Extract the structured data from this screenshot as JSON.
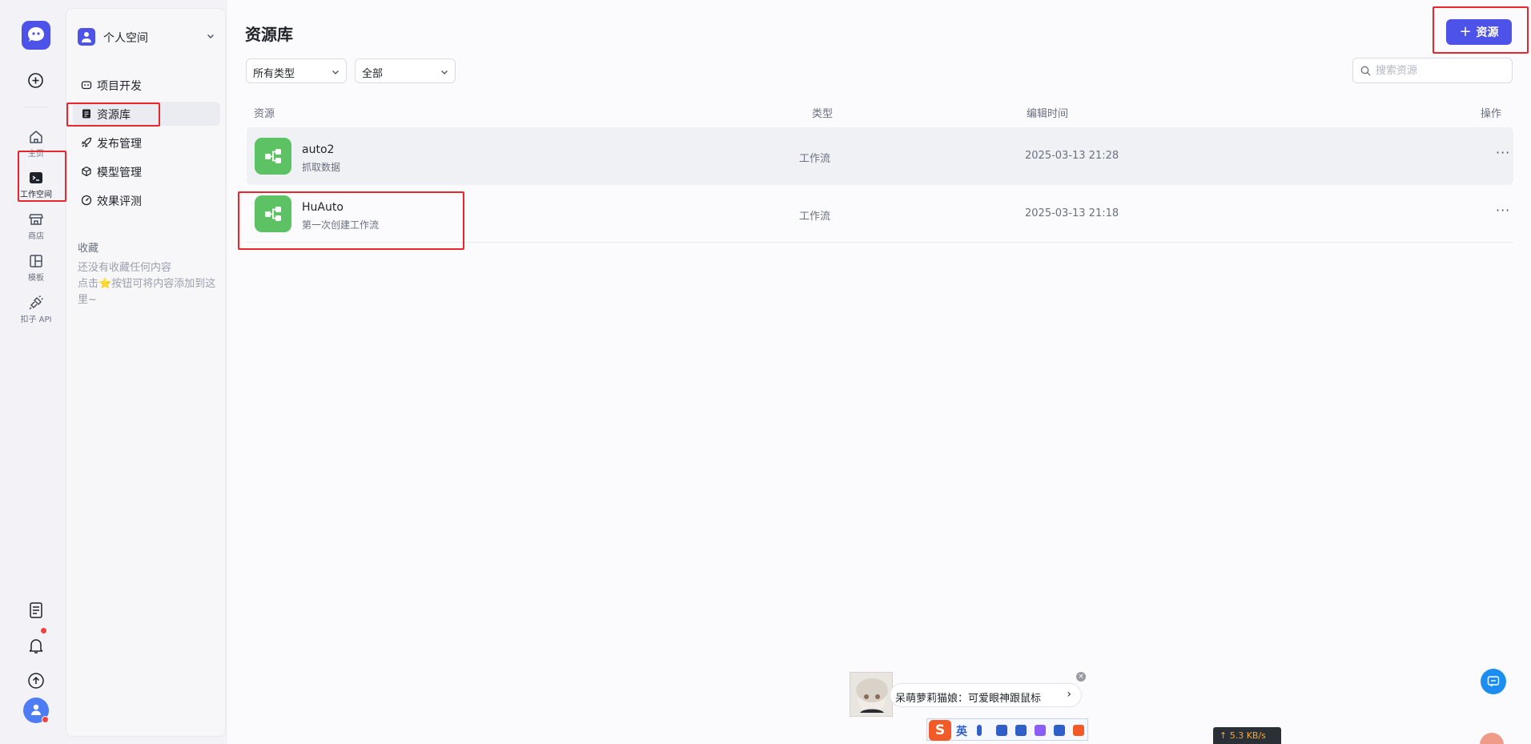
{
  "rail": {
    "items": [
      {
        "label": "主页"
      },
      {
        "label": "工作空间"
      },
      {
        "label": "商店"
      },
      {
        "label": "模板"
      },
      {
        "label": "扣子 API"
      }
    ]
  },
  "sidebar": {
    "workspace_name": "个人空间",
    "nav": [
      {
        "label": "项目开发"
      },
      {
        "label": "资源库"
      },
      {
        "label": "发布管理"
      },
      {
        "label": "模型管理"
      },
      {
        "label": "效果评测"
      }
    ],
    "favorites_title": "收藏",
    "favorites_empty_line1": "还没有收藏任何内容",
    "favorites_empty_pre": "点击",
    "favorites_star": "⭐",
    "favorites_empty_post": "按钮可将内容添加到这里~"
  },
  "main": {
    "title": "资源库",
    "add_button": {
      "icon": "+",
      "label": "资源"
    },
    "filters": {
      "type_value": "所有类型",
      "scope_value": "全部"
    },
    "search": {
      "placeholder": "搜索资源"
    },
    "columns": {
      "resource": "资源",
      "type": "类型",
      "edited": "编辑时间",
      "actions": "操作"
    },
    "rows": [
      {
        "name": "auto2",
        "desc": "抓取数据",
        "type": "工作流",
        "time": "2025-03-13 21:28",
        "more": "···"
      },
      {
        "name": "HuAuto",
        "desc": "第一次创建工作流",
        "type": "工作流",
        "time": "2025-03-13 21:18",
        "more": "···"
      }
    ]
  },
  "overlays": {
    "popup_text": "呆萌萝莉猫娘：可爱眼神跟鼠标",
    "popup_arrow": "›",
    "popup_close": "×",
    "ime_logo": "S",
    "ime_lang": "英",
    "net_speed": "↑ 5.3 KB/s"
  },
  "colors": {
    "accent": "#4d53e8",
    "workflow_icon": "#5dc264",
    "annotation": "#e8262b"
  }
}
